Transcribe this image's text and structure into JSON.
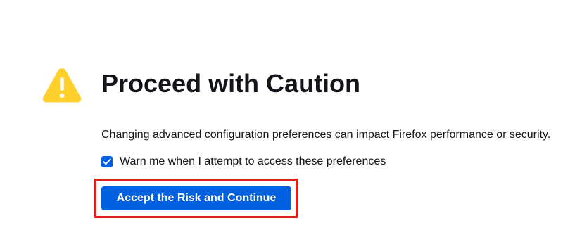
{
  "warning": {
    "icon": "warning-triangle-icon",
    "color": "#ffd02b",
    "mark_color": "#ffffff"
  },
  "title": "Proceed with Caution",
  "description": "Changing advanced configuration preferences can impact Firefox performance or security.",
  "warn_checkbox": {
    "label": "Warn me when I attempt to access these preferences",
    "checked": true,
    "color": "#0061e0"
  },
  "accept_button": {
    "label": "Accept the Risk and Continue",
    "color": "#0061e0",
    "highlight_color": "#e0201b"
  }
}
